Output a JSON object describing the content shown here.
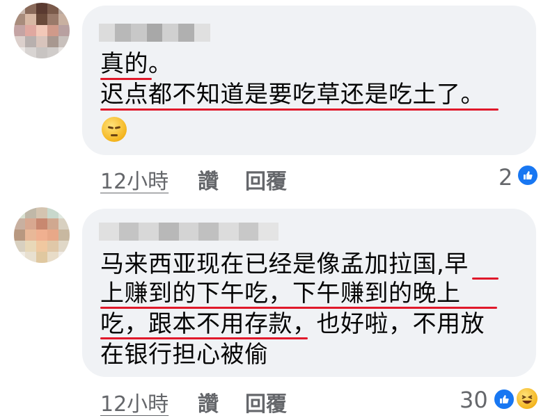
{
  "comments": [
    {
      "text_lines": [
        "真的。",
        "迟点都不知道是要吃草还是吃土了。"
      ],
      "emoji": "pensive-face",
      "meta": {
        "time": "12小時",
        "like_label": "讚",
        "reply_label": "回覆"
      },
      "reaction_count": "2",
      "reactions": [
        "like"
      ]
    },
    {
      "text_lines": [
        "马来西亚现在已经是像孟加拉国,早",
        "上赚到的下午吃，下午赚到的晚上",
        "吃，跟本不用存款，也好啦，不用放",
        "在银行担心被偷"
      ],
      "meta": {
        "time": "12小時",
        "like_label": "讚",
        "reply_label": "回覆"
      },
      "reaction_count": "30",
      "reactions": [
        "like",
        "haha"
      ]
    }
  ],
  "colors": {
    "bubble": "#f0f2f5",
    "underline": "#e0182a",
    "meta_text": "#65676b",
    "like_blue": "#1877f2"
  }
}
